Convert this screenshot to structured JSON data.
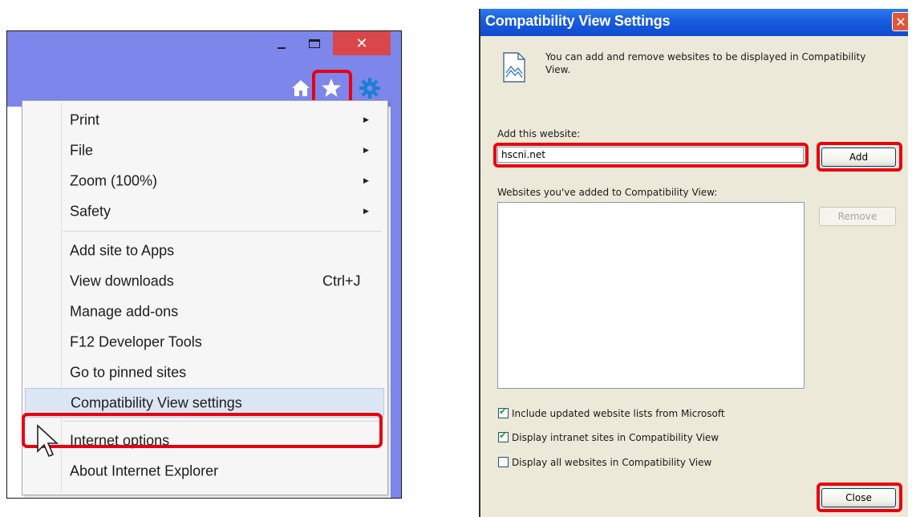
{
  "ie_window": {
    "titlebar_color": "#7d86ea",
    "minimize_icon": "minimize-icon",
    "maximize_icon": "maximize-icon",
    "close_glyph": "✕",
    "command_icons": [
      "home-icon",
      "favorites-star-icon",
      "gear-icon"
    ],
    "tools_menu": {
      "items": [
        {
          "label": "Print",
          "submenu": true
        },
        {
          "label": "File",
          "submenu": true
        },
        {
          "label": "Zoom (100%)",
          "submenu": true
        },
        {
          "label": "Safety",
          "submenu": true
        },
        {
          "label": "Add site to Apps"
        },
        {
          "label": "View downloads",
          "shortcut": "Ctrl+J"
        },
        {
          "label": "Manage add-ons"
        },
        {
          "label": "F12 Developer Tools"
        },
        {
          "label": "Go to pinned sites"
        },
        {
          "label": "Compatibility View settings",
          "highlighted": true
        },
        {
          "label": "Internet options"
        },
        {
          "label": "About Internet Explorer"
        }
      ],
      "submenu_arrow": "▶"
    }
  },
  "dialog": {
    "title": "Compatibility View Settings",
    "close_glyph": "✕",
    "description": "You can add and remove websites to be displayed in Compatibility View.",
    "add_label": "Add this website:",
    "website_input_value": "hscni.net",
    "add_button": "Add",
    "list_label": "Websites you've added to Compatibility View:",
    "remove_button": "Remove",
    "checkboxes": [
      {
        "label": "Include updated website lists from Microsoft",
        "checked": true
      },
      {
        "label": "Display intranet sites in Compatibility View",
        "checked": true
      },
      {
        "label": "Display all websites in Compatibility View",
        "checked": false
      }
    ],
    "check_glyph": "✔",
    "close_button": "Close"
  },
  "colors": {
    "highlight_red": "#e8000e",
    "xp_title_blue": "#1a5fde",
    "menu_highlight": "#dbe6f4"
  }
}
